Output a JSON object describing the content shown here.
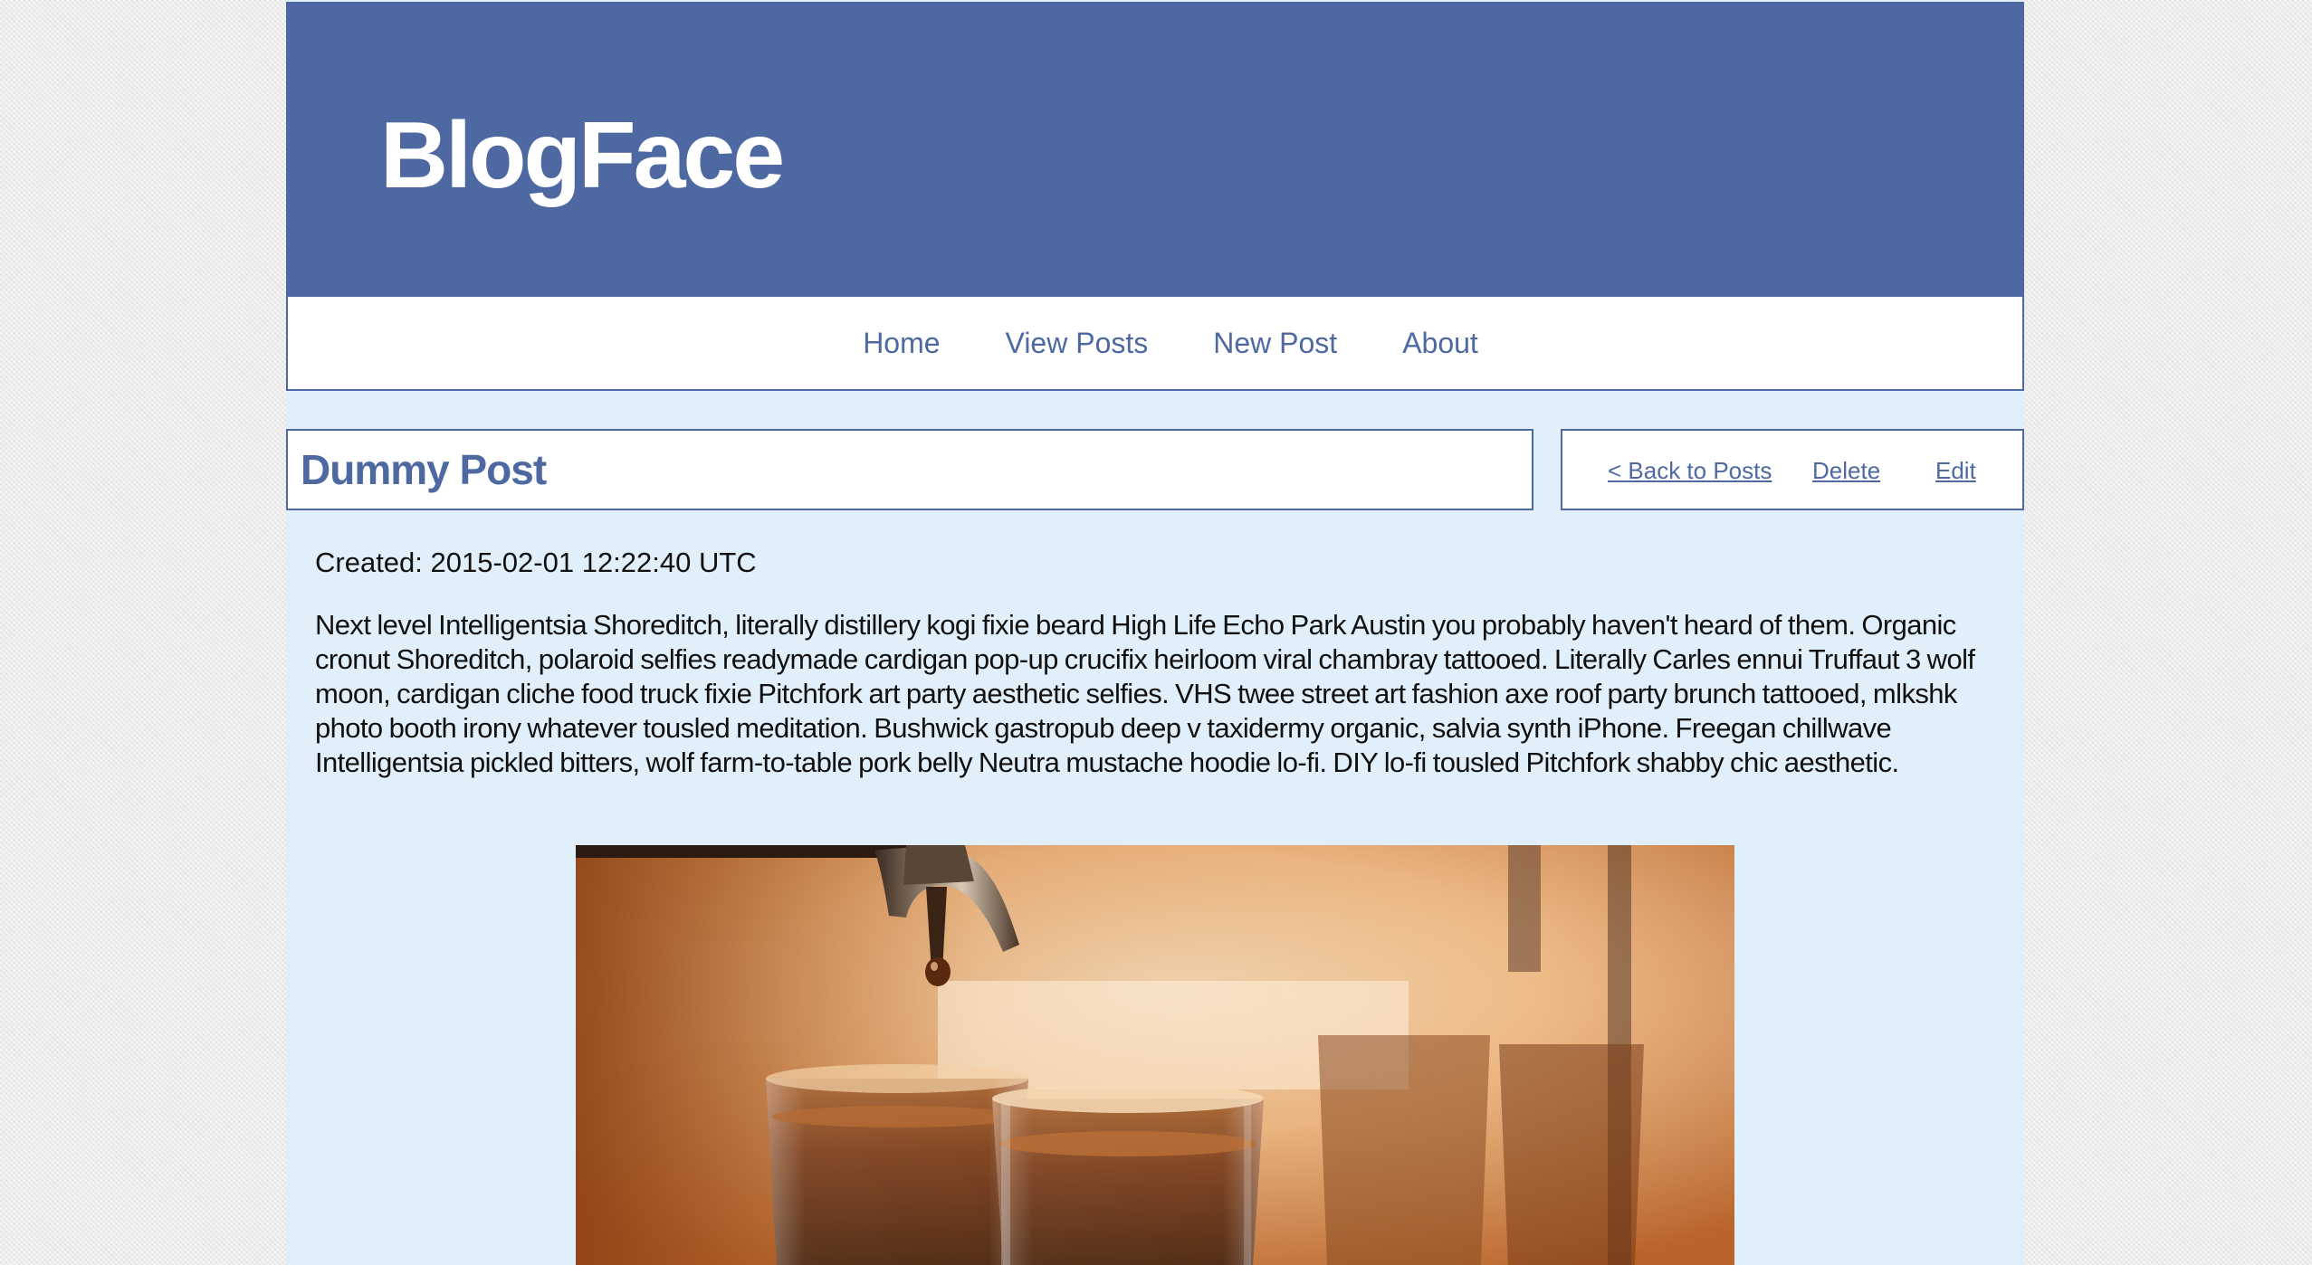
{
  "site": {
    "title": "BlogFace"
  },
  "nav": {
    "items": [
      {
        "label": "Home"
      },
      {
        "label": "View Posts"
      },
      {
        "label": "New Post"
      },
      {
        "label": "About"
      }
    ]
  },
  "post": {
    "title": "Dummy Post",
    "actions": {
      "back_label": "< Back to Posts",
      "delete_label": "Delete",
      "edit_label": "Edit"
    },
    "created": "Created: 2015-02-01 12:22:40 UTC",
    "body": "Next level Intelligentsia Shoreditch, literally distillery kogi fixie beard High Life Echo Park Austin you probably haven't heard of them. Organic cronut Shoreditch, polaroid selfies readymade cardigan pop-up crucifix heirloom viral chambray tattooed. Literally Carles ennui Truffaut 3 wolf moon, cardigan cliche food truck fixie Pitchfork art party aesthetic selfies. VHS twee street art fashion axe roof party brunch tattooed, mlkshk photo booth irony whatever tousled meditation. Bushwick gastropub deep v taxidermy organic, salvia synth iPhone. Freegan chillwave Intelligentsia pickled bitters, wolf farm-to-table pork belly Neutra mustache hoodie lo-fi. DIY lo-fi tousled Pitchfork shabby chic aesthetic."
  },
  "colors": {
    "brand": "#4e69a1",
    "content_background": "#e1effa",
    "page_background": "#ececec"
  }
}
